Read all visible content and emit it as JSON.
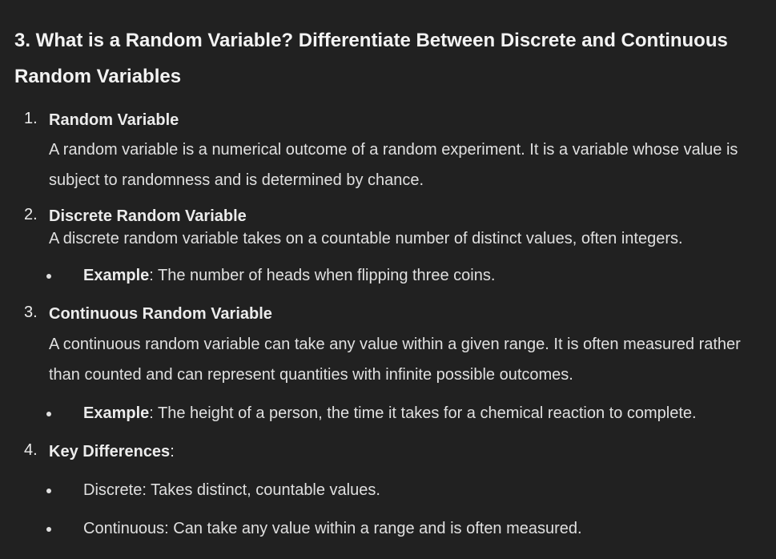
{
  "heading": "3. What is a Random Variable? Differentiate Between Discrete and Continuous Random Variables",
  "items": [
    {
      "number": "1.",
      "title": "Random Variable",
      "text": "A random variable is a numerical outcome of a random experiment. It is a variable whose value is subject to randomness and is determined by chance."
    },
    {
      "number": "2.",
      "title": "Discrete Random Variable",
      "text": "A discrete random variable takes on a countable number of distinct values, often integers.",
      "bullet_label": "Example",
      "bullet_text": ": The number of heads when flipping three coins."
    },
    {
      "number": "3.",
      "title": "Continuous Random Variable",
      "text": "A continuous random variable can take any value within a given range. It is often measured rather than counted and can represent quantities with infinite possible outcomes.",
      "bullet_label": "Example",
      "bullet_text": ": The height of a person, the time it takes for a chemical reaction to complete."
    },
    {
      "number": "4.",
      "title": "Key Differences",
      "title_suffix": ":",
      "bullets": [
        "Discrete: Takes distinct, countable values.",
        "Continuous: Can take any value within a range and is often measured."
      ]
    }
  ]
}
